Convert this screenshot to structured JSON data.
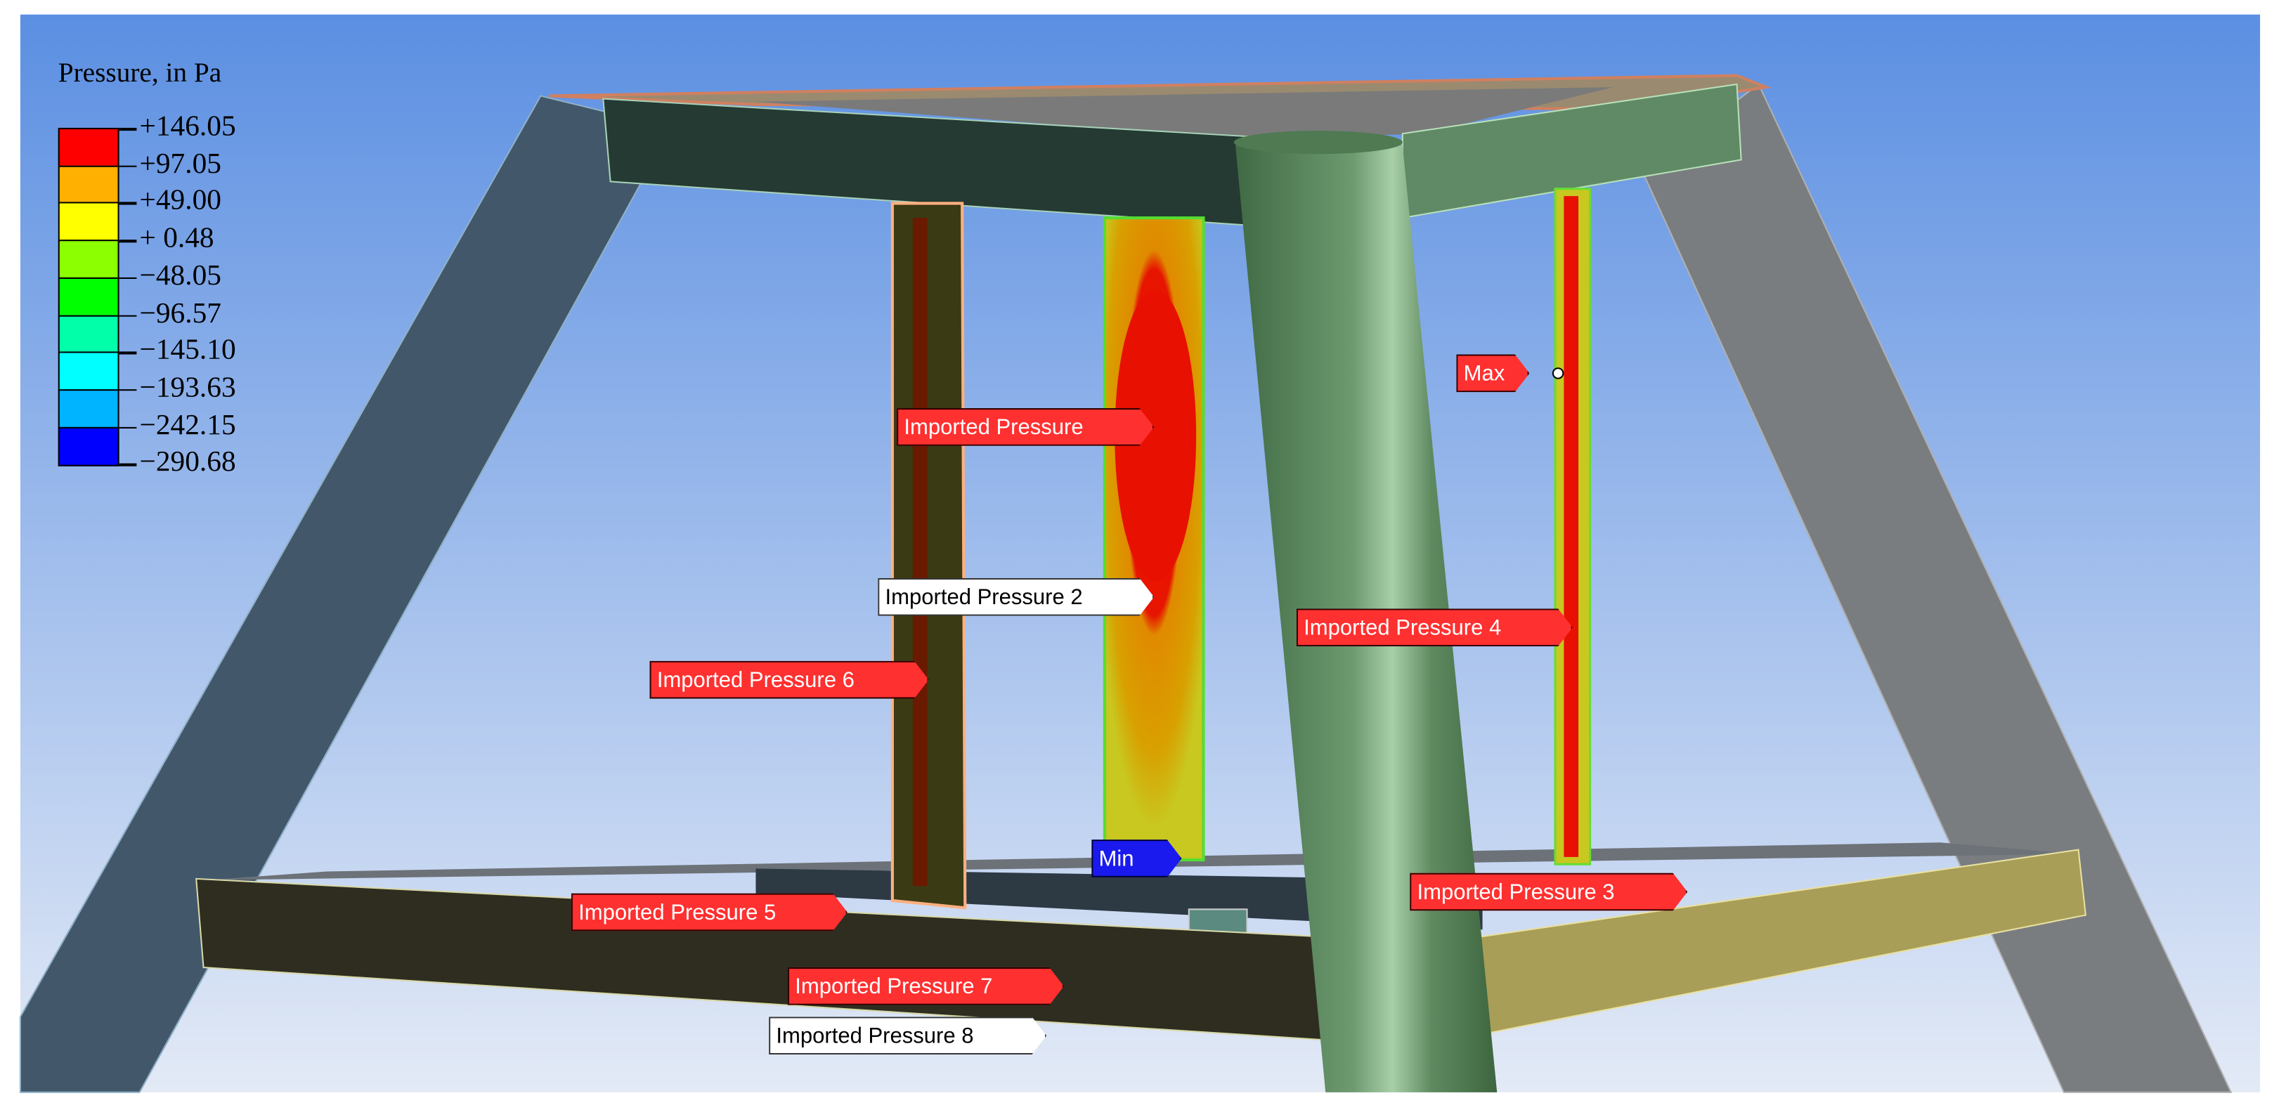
{
  "legend": {
    "title": "Pressure, in Pa",
    "labels": [
      "+146.05",
      "+97.05",
      "+49.00",
      "+ 0.48",
      "−48.05",
      "−96.57",
      "−145.10",
      "−193.63",
      "−242.15",
      "−290.68"
    ],
    "colors": [
      "#ff0000",
      "#ffb000",
      "#ffff00",
      "#8cff00",
      "#00ff00",
      "#00ffa8",
      "#00ffff",
      "#00b4ff",
      "#0000ff"
    ]
  },
  "probes": {
    "max": "Max",
    "min": "Min"
  },
  "loads": {
    "p1": "Imported Pressure",
    "p2": "Imported Pressure 2",
    "p3": "Imported Pressure 3",
    "p4": "Imported Pressure 4",
    "p5": "Imported Pressure 5",
    "p6": "Imported Pressure 6",
    "p7": "Imported Pressure 7",
    "p8": "Imported Pressure 8"
  }
}
